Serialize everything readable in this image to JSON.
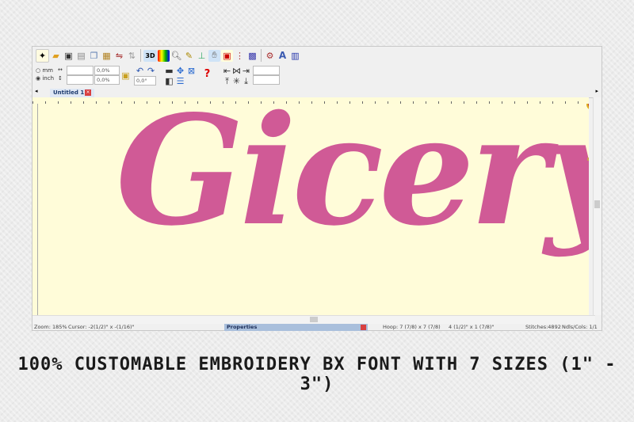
{
  "toolbar": {
    "icons": [
      "new-file",
      "open-folder",
      "save",
      "print",
      "copy",
      "paste",
      "mirror",
      "flip",
      "3d",
      "color-chart",
      "zoom",
      "measure",
      "hoop",
      "hand",
      "view",
      "needle",
      "palette",
      "stitch-settings",
      "text",
      "bars"
    ],
    "three_d_label": "3D"
  },
  "units": {
    "mm": "mm",
    "inch": "inch",
    "selected": "inch"
  },
  "transform": {
    "width_value": "",
    "height_value": "",
    "width_pct": "0,0%",
    "height_pct": "0,0%",
    "rotation": "0,0°"
  },
  "tab": {
    "label": "Untitled 1 *"
  },
  "design": {
    "text": "Gicery",
    "color": "#d05a96",
    "background": "#fffcd9"
  },
  "status": {
    "zoom": "Zoom: 185%",
    "cursor": "Cursor: -2(1/2)\" x -(1/16)\"",
    "properties": "Properties",
    "hoop": "Hoop: 7 (7/8) x 7 (7/8)",
    "size": "4 (1/2)\" x 1 (7/8)\"",
    "stitches": "Stitches:4892",
    "ndls": "Ndls/Cols: 1/1"
  },
  "caption": "100% CUSTOMABLE EMBROIDERY BX FONT WITH 7 SIZES (1\" -  3\")"
}
